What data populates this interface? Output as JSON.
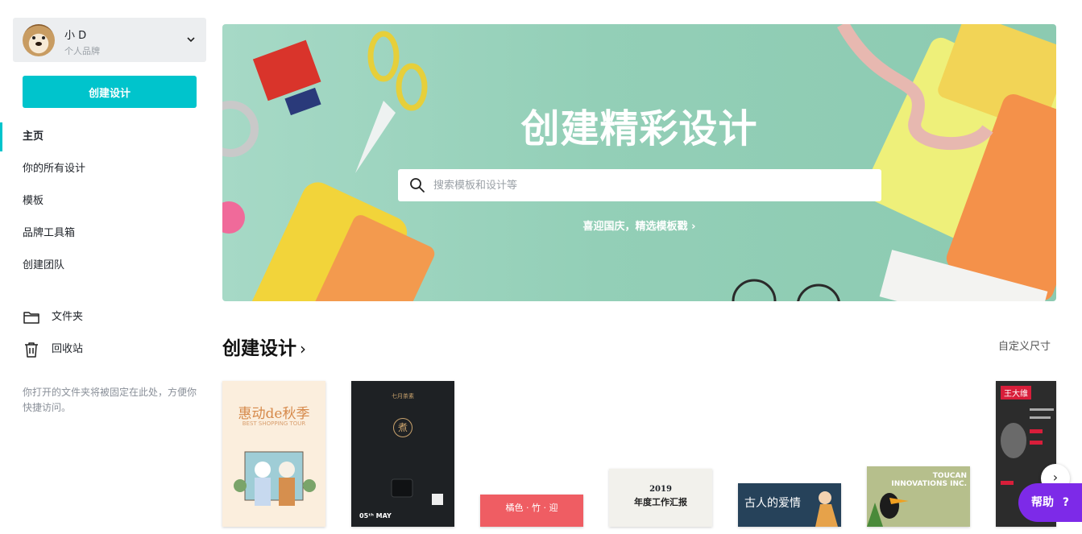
{
  "account": {
    "name": "小 D",
    "subtitle": "个人品牌"
  },
  "sidebar": {
    "create_button": "创建设计",
    "nav": [
      {
        "label": "主页",
        "active": true
      },
      {
        "label": "你的所有设计"
      },
      {
        "label": "模板"
      },
      {
        "label": "品牌工具箱"
      },
      {
        "label": "创建团队"
      }
    ],
    "folders": [
      {
        "label": "文件夹",
        "icon": "folder-icon"
      },
      {
        "label": "回收站",
        "icon": "trash-icon"
      }
    ],
    "hint": "你打开的文件夹将被固定在此处，方便你快捷访问。"
  },
  "hero": {
    "title": "创建精彩设计",
    "search_placeholder": "搜索模板和设计等",
    "link": "喜迎国庆，精选模板戳 ›"
  },
  "section": {
    "title": "创建设计",
    "chevron": "›",
    "custom_size": "自定义尺寸"
  },
  "cards": {
    "c1": {
      "title": "惠动de秋季",
      "sub": "BEST SHOPPING TOUR"
    },
    "c2": {
      "top": "七月茶素",
      "seal": "煮",
      "date": "05ᵗʰ MAY"
    },
    "c3": {
      "text": "橘色 · 竹 · 迎"
    },
    "c4": {
      "year": "2019",
      "text": "年度工作汇报"
    },
    "c5": {
      "text": "古人的爱情"
    },
    "c6": {
      "line1": "TOUCAN",
      "line2": "INNOVATIONS INC."
    },
    "c7": {
      "name": "王大维"
    }
  },
  "next_button": "›",
  "help": {
    "label": "帮助",
    "icon_glyph": "?"
  },
  "colors": {
    "accent": "#00c4cc",
    "help": "#7d2ae8",
    "hero_bg": "#93cfb7"
  }
}
